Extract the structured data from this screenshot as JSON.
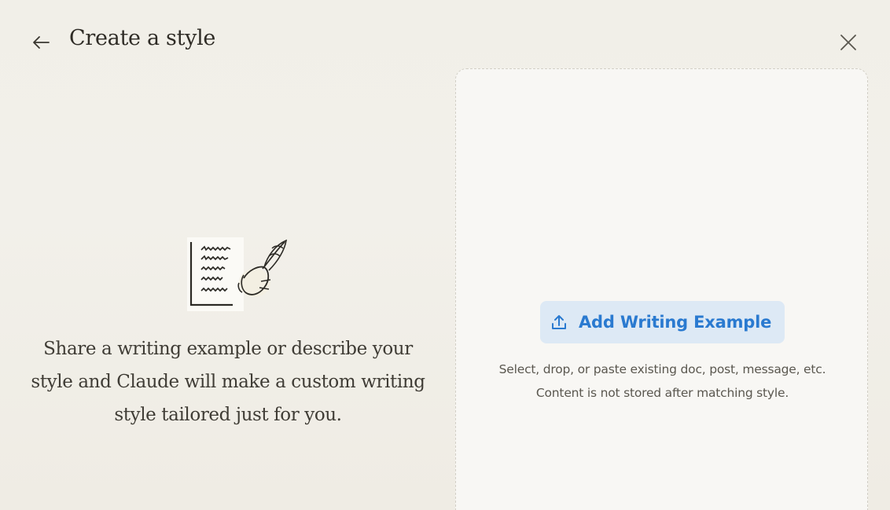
{
  "header": {
    "title": "Create a style",
    "back_icon": "arrow-left-icon",
    "close_icon": "close-icon"
  },
  "intro": {
    "illustration": "handwriting-quill-illustration",
    "description": "Share a writing example or describe your style and Claude will make a custom writing style tailored just for you."
  },
  "upload": {
    "button_label": "Add Writing Example",
    "button_icon": "upload-icon",
    "hint_line1": "Select, drop, or paste existing doc, post, message, etc.",
    "hint_line2": "Content is not stored after matching style."
  },
  "colors": {
    "accent": "#2a7ad0",
    "button_bg": "#dde9f5",
    "background": "#f1efe8",
    "panel_bg": "#f8f7f4",
    "text": "#3d3a33"
  }
}
